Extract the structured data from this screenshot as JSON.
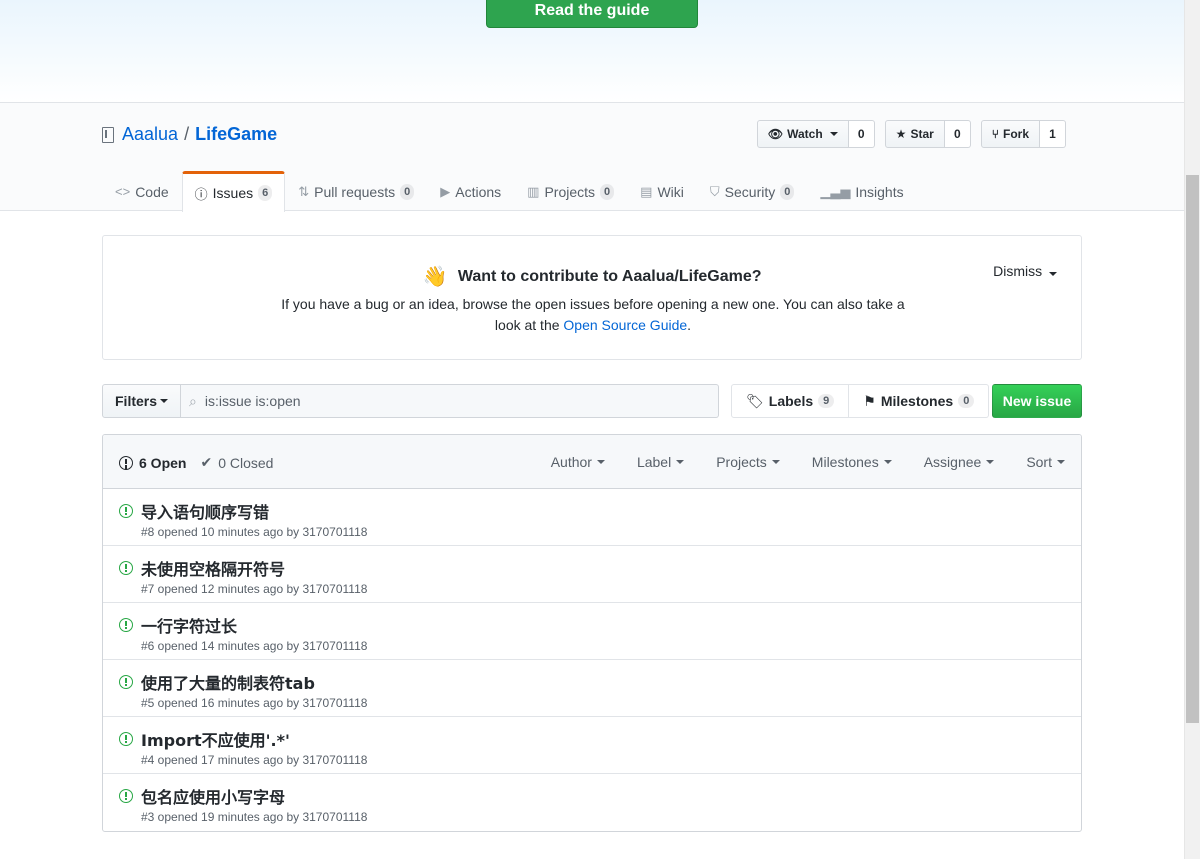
{
  "banner": {
    "guide_button": "Read the guide"
  },
  "repo": {
    "owner": "Aaalua",
    "separator": "/",
    "name": "LifeGame",
    "watch": {
      "label": "Watch",
      "count": "0"
    },
    "star": {
      "label": "Star",
      "count": "0"
    },
    "fork": {
      "label": "Fork",
      "count": "1"
    }
  },
  "tabs": [
    {
      "label": "Code",
      "icon": "code-icon"
    },
    {
      "label": "Issues",
      "count": "6",
      "icon": "issue-icon",
      "selected": true
    },
    {
      "label": "Pull requests",
      "count": "0",
      "icon": "pr-icon"
    },
    {
      "label": "Actions",
      "icon": "play-icon"
    },
    {
      "label": "Projects",
      "count": "0",
      "icon": "project-icon"
    },
    {
      "label": "Wiki",
      "icon": "book-icon"
    },
    {
      "label": "Security",
      "count": "0",
      "icon": "shield-icon"
    },
    {
      "label": "Insights",
      "icon": "graph-icon"
    }
  ],
  "contribute": {
    "title": "Want to contribute to Aaalua/LifeGame?",
    "text_before": "If you have a bug or an idea, browse the open issues before opening a new one. You can also take a look at the ",
    "link": "Open Source Guide",
    "text_after": ".",
    "dismiss": "Dismiss"
  },
  "subnav": {
    "filters": "Filters",
    "search_value": "is:issue is:open",
    "labels": "Labels",
    "labels_count": "9",
    "milestones": "Milestones",
    "milestones_count": "0",
    "new_issue": "New issue"
  },
  "issues_header": {
    "open": "6 Open",
    "closed": "0 Closed",
    "filters": [
      "Author",
      "Label",
      "Projects",
      "Milestones",
      "Assignee",
      "Sort"
    ]
  },
  "issues": [
    {
      "title": "导入语句顺序写错",
      "meta": "#8 opened 10 minutes ago by 3170701118"
    },
    {
      "title": "未使用空格隔开符号",
      "meta": "#7 opened 12 minutes ago by 3170701118"
    },
    {
      "title": "一行字符过长",
      "meta": "#6 opened 14 minutes ago by 3170701118"
    },
    {
      "title": "使用了大量的制表符tab",
      "meta": "#5 opened 16 minutes ago by 3170701118"
    },
    {
      "title": "Import不应使用'.*'",
      "meta": "#4 opened 17 minutes ago by 3170701118"
    },
    {
      "title": "包名应使用小写字母",
      "meta": "#3 opened 19 minutes ago by 3170701118"
    }
  ],
  "colors": {
    "green": "#2ea44f",
    "link": "#0366d6",
    "tab_accent": "#e36209",
    "open_icon": "#28a745"
  }
}
